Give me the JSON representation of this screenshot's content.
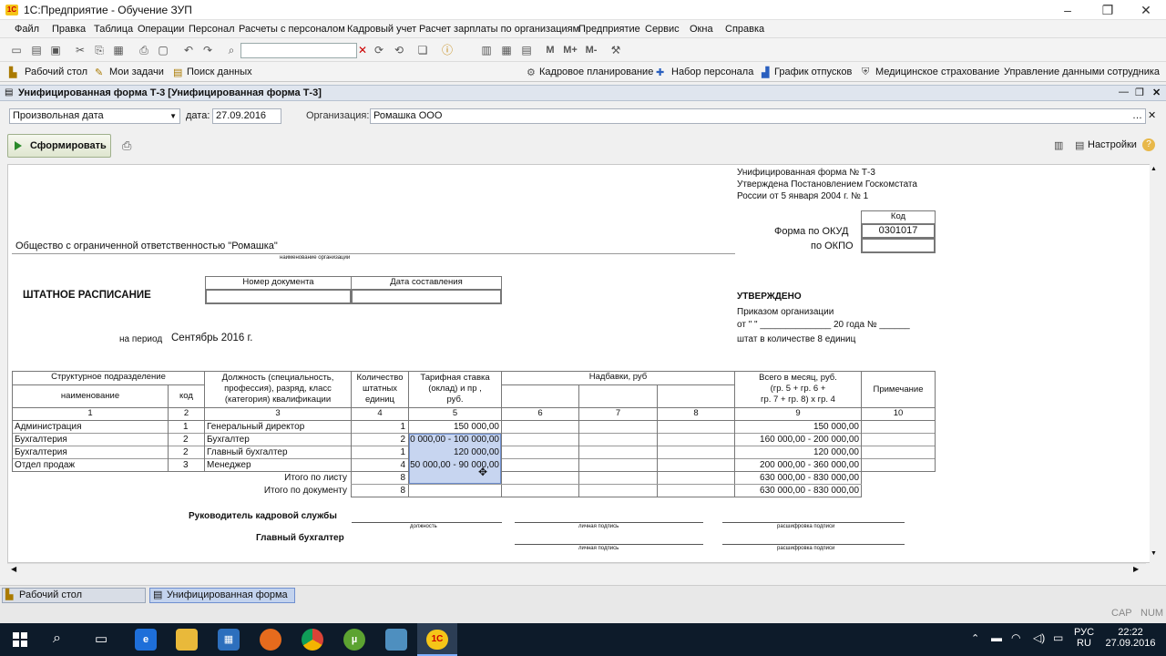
{
  "window": {
    "title": "1С:Предприятие - Обучение ЗУП"
  },
  "menu": [
    "Файл",
    "Правка",
    "Таблица",
    "Операции",
    "Персонал",
    "Расчеты с персоналом",
    "Кадровый учет",
    "Расчет зарплаты по организациям",
    "Предприятие",
    "Сервис",
    "Окна",
    "Справка"
  ],
  "toolbar_mode_buttons": [
    "М",
    "М+",
    "М-"
  ],
  "quick_toolbar": {
    "desktop": "Рабочий стол",
    "tasks": "Мои задачи",
    "search": "Поиск данных",
    "staff_planning": "Кадровое планирование",
    "recruiting": "Набор персонала",
    "vacations": "График отпусков",
    "insurance": "Медицинское страхование",
    "employee_data": "Управление данными сотрудника"
  },
  "document": {
    "title": "Унифицированная форма Т-3 [Унифицированная форма Т-3]",
    "period_type": "Произвольная дата",
    "date_label": "дата:",
    "date_value": "27.09.2016",
    "org_label": "Организация:",
    "org_value": "Ромашка ООО",
    "generate_button": "Сформировать",
    "settings_button": "Настройки"
  },
  "report": {
    "header_lines": [
      "Унифицированная форма № Т-3",
      "Утверждена Постановлением Госкомстата",
      "России от 5 января 2004 г. № 1"
    ],
    "code_label": "Код",
    "okud_label": "Форма по ОКУД",
    "okud_value": "0301017",
    "okpo_label": "по ОКПО",
    "org_name": "Общество с ограниченной ответственностью \"Ромашка\"",
    "org_caption": "наименование организации",
    "doc_title": "ШТАТНОЕ РАСПИСАНИЕ",
    "doc_number_label": "Номер документа",
    "doc_date_label": "Дата составления",
    "approved": "УТВЕРЖДЕНО",
    "order_label": "Приказом организации",
    "order_line": "от \"      \" ______________ 20      года № ______",
    "staff_count": "штат в количестве 8 единиц",
    "period_label": "на период",
    "period_value": "Сентябрь 2016 г.",
    "col_headers": {
      "division": "Структурное  подразделение",
      "name": "наименование",
      "code": "код",
      "position": [
        "Должность (специальность,",
        "профессия), разряд, класс",
        "(категория) квалификации"
      ],
      "count": [
        "Количество",
        "штатных",
        "единиц"
      ],
      "rate": [
        "Тарифная ставка",
        "(оклад) и пр ,",
        "руб."
      ],
      "allowances": "Надбавки, руб",
      "total": [
        "Всего в месяц, руб.",
        "(гр. 5 + гр. 6 +",
        "гр. 7 + гр. 8) х гр. 4"
      ],
      "note": "Примечание"
    },
    "col_numbers": [
      "1",
      "2",
      "3",
      "4",
      "5",
      "6",
      "7",
      "8",
      "9",
      "10"
    ],
    "rows": [
      {
        "division": "Администрация",
        "code": "1",
        "position": "Генеральный директор",
        "count": "1",
        "rate": "150 000,00",
        "total": "150 000,00"
      },
      {
        "division": "Бухгалтерия",
        "code": "2",
        "position": "Бухгалтер",
        "count": "2",
        "rate": "0 000,00 - 100 000,00",
        "total": "160 000,00 - 200 000,00"
      },
      {
        "division": "Бухгалтерия",
        "code": "2",
        "position": "Главный бухгалтер",
        "count": "1",
        "rate": "120 000,00",
        "total": "120 000,00"
      },
      {
        "division": "Отдел продаж",
        "code": "3",
        "position": "Менеджер",
        "count": "4",
        "rate": "50 000,00 - 90 000,00",
        "total": "200 000,00 - 360 000,00"
      }
    ],
    "total_sheet_label": "Итого по листу",
    "total_sheet_count": "8",
    "total_sheet_sum": "630 000,00 - 830 000,00",
    "total_doc_label": "Итого по документу",
    "total_doc_count": "8",
    "total_doc_sum": "630 000,00 - 830 000,00",
    "hr_head": "Руководитель кадровой службы",
    "chief_accountant": "Главный бухгалтер",
    "cap_position": "должность",
    "cap_signature": "личная подпись",
    "cap_decoding": "расшифровка подписи"
  },
  "tabs": {
    "desktop": "Рабочий стол",
    "form": "Унифицированная форма Т..."
  },
  "status": {
    "cap": "CAP",
    "num": "NUM"
  },
  "taskbar": {
    "lang_top": "РУС",
    "lang_bottom": "RU",
    "time": "22:22",
    "date": "27.09.2016"
  },
  "colors": {
    "accent": "#2a8a2a",
    "selection": "#c7d5f0",
    "taskbar": "#0d1b2a"
  }
}
